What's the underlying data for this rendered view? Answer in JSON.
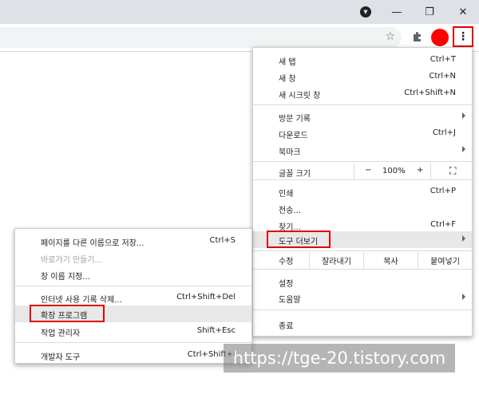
{
  "browser": {
    "window_controls": {
      "profile_icon": "▼",
      "minimize": "—",
      "restore": "❐",
      "close": "✕"
    },
    "omnibox": {
      "value": ""
    },
    "star_icon": "☆",
    "extensions_icon": "puzzle-icon",
    "avatar_color": "#ff0000",
    "menu_icon": "⋮"
  },
  "main_menu": {
    "items_top": [
      {
        "label": "새 탭",
        "shortcut": "Ctrl+T"
      },
      {
        "label": "새 창",
        "shortcut": "Ctrl+N"
      },
      {
        "label": "새 시크릿 창",
        "shortcut": "Ctrl+Shift+N"
      }
    ],
    "items_history": [
      {
        "label": "방문 기록",
        "shortcut": ""
      },
      {
        "label": "다운로드",
        "shortcut": "Ctrl+J"
      },
      {
        "label": "북마크",
        "shortcut": ""
      }
    ],
    "zoom": {
      "label": "글꼴 크기",
      "minus": "−",
      "value": "100%",
      "plus": "+",
      "fullscreen": "⛶"
    },
    "items_tools": [
      {
        "label": "인쇄",
        "shortcut": "Ctrl+P"
      },
      {
        "label": "전송...",
        "shortcut": ""
      },
      {
        "label": "찾기...",
        "shortcut": "Ctrl+F"
      },
      {
        "label": "도구 더보기",
        "shortcut": ""
      }
    ],
    "edit": {
      "label": "수정",
      "cut": "잘라내기",
      "copy": "복사",
      "paste": "붙여넣기"
    },
    "items_settings": [
      {
        "label": "설정"
      },
      {
        "label": "도움말"
      }
    ],
    "exit": {
      "label": "종료"
    }
  },
  "sub_menu": {
    "items_a": [
      {
        "label": "페이지를 다른 이름으로 저장...",
        "shortcut": "Ctrl+S"
      },
      {
        "label": "바로가기 만들기...",
        "shortcut": ""
      },
      {
        "label": "창 이름 지정...",
        "shortcut": ""
      }
    ],
    "items_b": [
      {
        "label": "인터넷 사용 기록 삭제...",
        "shortcut": "Ctrl+Shift+Del"
      },
      {
        "label": "확장 프로그램",
        "shortcut": ""
      },
      {
        "label": "작업 관리자",
        "shortcut": "Shift+Esc"
      }
    ],
    "items_c": [
      {
        "label": "개발자 도구",
        "shortcut": "Ctrl+Shift+I"
      }
    ]
  },
  "watermark": "https://tge-20.tistory.com"
}
